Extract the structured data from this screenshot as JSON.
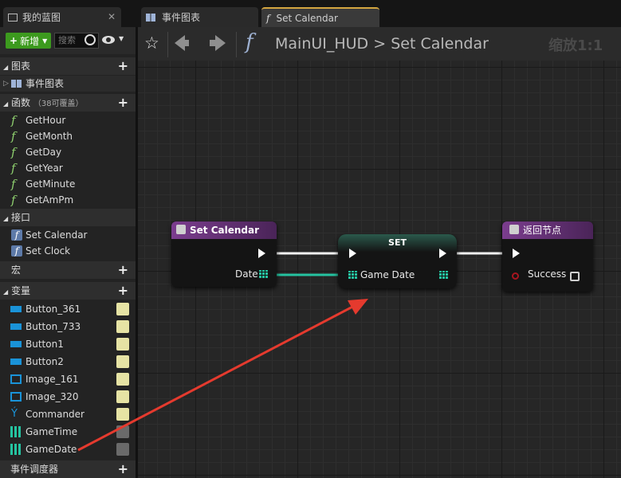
{
  "tabs": {
    "blueprint": {
      "label": "我的蓝图"
    },
    "event_graph": {
      "label": "事件图表"
    },
    "set_calendar": {
      "label": "Set Calendar"
    }
  },
  "left_panel": {
    "add_button": "新增",
    "search_placeholder": "搜索",
    "graphs_header": "图表",
    "event_graph_item": "事件图表",
    "functions_header": "函数",
    "functions_note": "（38可覆盖）",
    "functions": [
      "GetHour",
      "GetMonth",
      "GetDay",
      "GetYear",
      "GetMinute",
      "GetAmPm"
    ],
    "interfaces_header": "接口",
    "interfaces": [
      "Set Calendar",
      "Set Clock"
    ],
    "macros_header": "宏",
    "variables_header": "变量",
    "variables": [
      "Button_361",
      "Button_733",
      "Button1",
      "Button2",
      "Image_161",
      "Image_320",
      "Commander",
      "GameTime",
      "GameDate"
    ],
    "dispatchers_header": "事件调度器"
  },
  "graph_toolbar": {
    "breadcrumb_root": "MainUI_HUD",
    "breadcrumb_sep": ">",
    "breadcrumb_current": "Set Calendar",
    "zoom": "缩放1:1"
  },
  "nodes": {
    "entry": {
      "title": "Set Calendar",
      "pin_date": "Date"
    },
    "set": {
      "title": "SET",
      "pin_game_date": "Game Date"
    },
    "return": {
      "title": "返回节点",
      "pin_success": "Success"
    }
  },
  "colors": {
    "accent_green": "#3c9a1e",
    "annotation_arrow": "#e53a2e",
    "struct_pin": "#25c3a0",
    "function_header": "#6a2a7e"
  }
}
